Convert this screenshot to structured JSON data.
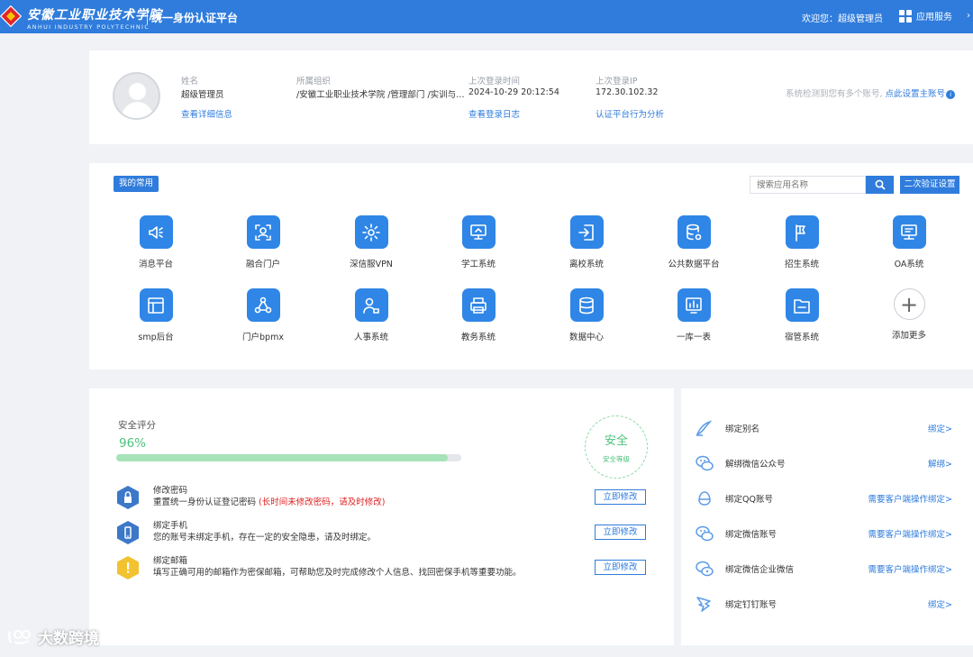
{
  "header": {
    "logo_cn": "安徽工业职业技术学院",
    "logo_en": "ANHUI INDUSTRY POLYTECHNIC",
    "title": "统一身份认证平台",
    "welcome": "欢迎您：超级管理员",
    "app_service": "应用服务",
    "brand_color": "#2f7cdc"
  },
  "profile": {
    "name_label": "姓名",
    "name": "超级管理员",
    "name_link": "查看详细信息",
    "org_label": "所属组织",
    "org": "/安徽工业职业技术学院 /管理部门 /实训与…",
    "last_login_time_label": "上次登录时间",
    "last_login_time": "2024-10-29 20:12:54",
    "last_login_log_link": "查看登录日志",
    "last_login_ip_label": "上次登录IP",
    "last_login_ip": "172.30.102.32",
    "behavior_link": "认证平台行为分析",
    "multi_account_note": "系统检测到您有多个账号, ",
    "multi_account_link": "点此设置主账号"
  },
  "apps": {
    "tag": "我的常用",
    "search_placeholder": "搜索应用名称",
    "two_factor_button": "二次验证设置",
    "items": [
      {
        "label": "消息平台",
        "icon": "megaphone-icon"
      },
      {
        "label": "融合门户",
        "icon": "user-scan-icon"
      },
      {
        "label": "深信服VPN",
        "icon": "gear-icon"
      },
      {
        "label": "学工系统",
        "icon": "monitor-icon"
      },
      {
        "label": "离校系统",
        "icon": "exit-door-icon"
      },
      {
        "label": "公共数据平台",
        "icon": "database-gear-icon"
      },
      {
        "label": "招生系统",
        "icon": "flag-icon"
      },
      {
        "label": "OA系统",
        "icon": "computer-icon"
      },
      {
        "label": "smp后台",
        "icon": "layout-icon"
      },
      {
        "label": "门户bpmx",
        "icon": "triangle-nodes-icon"
      },
      {
        "label": "人事系统",
        "icon": "user-card-icon"
      },
      {
        "label": "教务系统",
        "icon": "printer-icon"
      },
      {
        "label": "数据中心",
        "icon": "database-icon"
      },
      {
        "label": "一库一表",
        "icon": "chart-board-icon"
      },
      {
        "label": "宿管系统",
        "icon": "folder-icon"
      },
      {
        "label": "添加更多",
        "icon": "plus-icon"
      }
    ]
  },
  "security": {
    "title": "安全评分",
    "score_text": "96%",
    "score_fraction": 0.96,
    "level": "安全",
    "level_caption": "安全等级",
    "items": [
      {
        "title": "修改密码",
        "desc": "重置统一身份认证登记密码 ",
        "warn": "(长时间未修改密码，请及时修改)",
        "button": "立即修改",
        "icon": "lock-icon",
        "color": "#3c78c8"
      },
      {
        "title": "绑定手机",
        "desc": "您的账号未绑定手机，存在一定的安全隐患，请及时绑定。",
        "warn": "",
        "button": "立即修改",
        "icon": "phone-icon",
        "color": "#3c78c8"
      },
      {
        "title": "绑定邮箱",
        "desc": "填写正确可用的邮箱作为密保邮箱，可帮助您及时完成修改个人信息、找回密保手机等重要功能。",
        "warn": "",
        "button": "立即修改",
        "icon": "exclamation-icon",
        "color": "#f2c230"
      }
    ]
  },
  "bindings": [
    {
      "label": "绑定别名",
      "action": "绑定>",
      "icon": "pen-icon"
    },
    {
      "label": "解绑微信公众号",
      "action": "解绑>",
      "icon": "wechat-icon"
    },
    {
      "label": "绑定QQ账号",
      "action": "需要客户端操作绑定>",
      "icon": "qq-icon"
    },
    {
      "label": "绑定微信账号",
      "action": "需要客户端操作绑定>",
      "icon": "wechat-icon"
    },
    {
      "label": "绑定微信企业微信",
      "action": "需要客户端操作绑定>",
      "icon": "wechat-work-icon"
    },
    {
      "label": "绑定钉钉账号",
      "action": "绑定>",
      "icon": "dingtalk-icon"
    }
  ],
  "watermark": "大数跨境"
}
